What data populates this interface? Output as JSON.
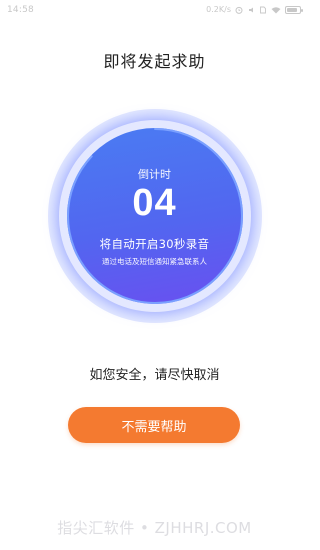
{
  "status_bar": {
    "time": "14:58",
    "network_speed": "0.2K/s",
    "icons": [
      "alarm-icon",
      "silent-icon",
      "sim-icon",
      "wifi-icon",
      "battery-icon"
    ],
    "battery_level": 0.8
  },
  "header": {
    "title": "即将发起求助"
  },
  "countdown": {
    "label": "倒计时",
    "seconds": "04",
    "message": "将自动开启30秒录音",
    "sub_message": "通过电话及短信通知紧急联系人",
    "progress": 0.87,
    "colors": {
      "start": "#4a7cf2",
      "end": "#6a4ff0",
      "ring": "#7aa0ff"
    }
  },
  "safety_message": "如您安全，请尽快取消",
  "cancel_button": {
    "label": "不需要帮助",
    "color": "#f47a30"
  },
  "watermark": "指尖汇软件 • ZJHHRJ.COM"
}
